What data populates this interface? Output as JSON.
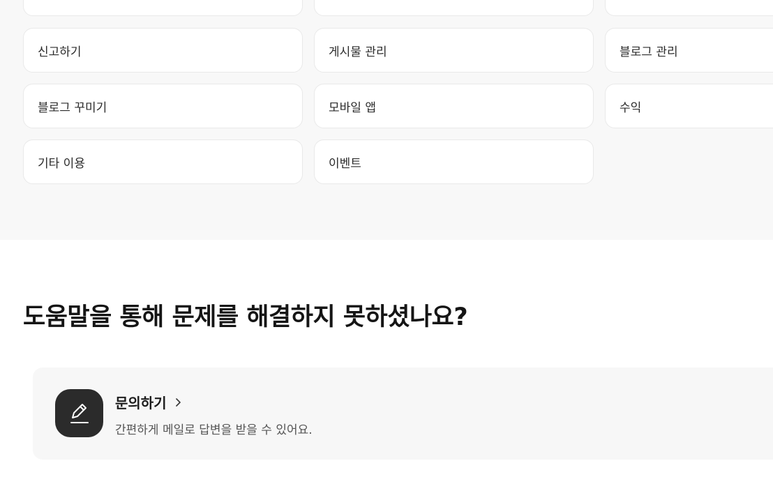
{
  "categories": {
    "row0": [
      "",
      "",
      ""
    ],
    "row1": [
      "신고하기",
      "게시물 관리",
      "블로그 관리"
    ],
    "row2": [
      "블로그 꾸미기",
      "모바일 앱",
      "수익"
    ],
    "row3": [
      "기타 이용",
      "이벤트"
    ]
  },
  "help": {
    "title": "도움말을 통해 문제를 해결하지 못하셨나요?",
    "inquiry": {
      "title": "문의하기",
      "description": "간편하게 메일로 답변을 받을 수 있어요.",
      "icon": "pencil-icon",
      "chevron_icon": "chevron-right-icon"
    }
  },
  "colors": {
    "section_bg": "#f8f8f8",
    "card_bg": "#ffffff",
    "icon_bg": "#2b2b2b",
    "inquiry_bg": "#f7f7f7"
  }
}
